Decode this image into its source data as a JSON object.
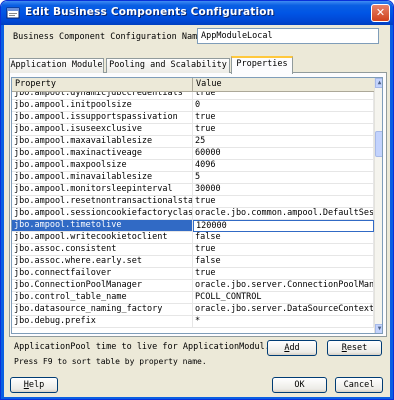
{
  "window": {
    "title": "Edit Business Components Configuration",
    "close_glyph": "✕"
  },
  "config_name": {
    "label": "Business Component Configuration Name:",
    "value": "AppModuleLocal"
  },
  "tabs": [
    {
      "label": "Application Module",
      "active": false
    },
    {
      "label": "Pooling and Scalability",
      "active": false
    },
    {
      "label": "Properties",
      "active": true
    }
  ],
  "table": {
    "columns": [
      "Property",
      "Value"
    ],
    "selected_row": "jbo.ampool.timetolive",
    "rows": [
      {
        "property": "jbo.ampool.dynamicjdbccredentials",
        "value": "true"
      },
      {
        "property": "jbo.ampool.initpoolsize",
        "value": "0"
      },
      {
        "property": "jbo.ampool.issupportspassivation",
        "value": "true"
      },
      {
        "property": "jbo.ampool.isuseexclusive",
        "value": "true"
      },
      {
        "property": "jbo.ampool.maxavailablesize",
        "value": "25"
      },
      {
        "property": "jbo.ampool.maxinactiveage",
        "value": "60000"
      },
      {
        "property": "jbo.ampool.maxpoolsize",
        "value": "4096"
      },
      {
        "property": "jbo.ampool.minavailablesize",
        "value": "5"
      },
      {
        "property": "jbo.ampool.monitorsleepinterval",
        "value": "30000"
      },
      {
        "property": "jbo.ampool.resetnontransactionalstate",
        "value": "true"
      },
      {
        "property": "jbo.ampool.sessioncookiefactoryclass",
        "value": "oracle.jbo.common.ampool.DefaultSess..."
      },
      {
        "property": "jbo.ampool.timetolive",
        "value": "120000"
      },
      {
        "property": "jbo.ampool.writecookietoclient",
        "value": "false"
      },
      {
        "property": "jbo.assoc.consistent",
        "value": "true"
      },
      {
        "property": "jbo.assoc.where.early.set",
        "value": "false"
      },
      {
        "property": "jbo.connectfailover",
        "value": "true"
      },
      {
        "property": "jbo.ConnectionPoolManager",
        "value": "oracle.jbo.server.ConnectionPoolMana..."
      },
      {
        "property": "jbo.control_table_name",
        "value": "PCOLL_CONTROL"
      },
      {
        "property": "jbo.datasource_naming_factory",
        "value": "oracle.jbo.server.DataSourceContextF..."
      },
      {
        "property": "jbo.debug.prefix",
        "value": "*"
      }
    ]
  },
  "description": "ApplicationPool time to live for ApplicationModul...",
  "hint": "Press F9 to sort table by property name.",
  "buttons": {
    "add": {
      "mnemonic": "A",
      "rest": "dd"
    },
    "reset": {
      "mnemonic": "R",
      "rest": "eset"
    },
    "help": {
      "mnemonic": "H",
      "rest": "elp"
    },
    "ok": "OK",
    "cancel": "Cancel"
  },
  "colors": {
    "titlebar": "#0055e5",
    "selection": "#316ac5",
    "dialog_bg": "#ece9d8",
    "active_tab_accent": "#ffc83c"
  },
  "icons": {
    "title": "app-window-icon",
    "scroll_up": "scroll-up-arrow-icon",
    "scroll_down": "scroll-down-arrow-icon"
  }
}
